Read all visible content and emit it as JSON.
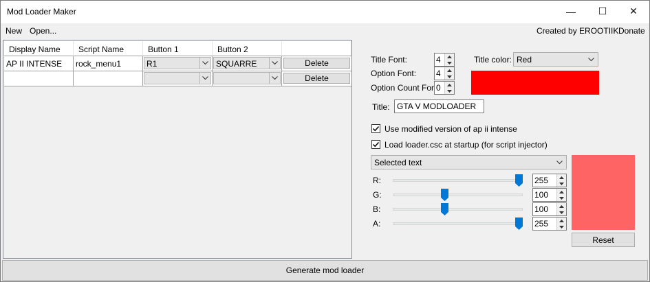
{
  "window": {
    "title": "Mod Loader Maker",
    "controls": {
      "minimize": "—",
      "maximize": "☐",
      "close": "✕"
    }
  },
  "menu": {
    "new_label": "New",
    "open_label": "Open...",
    "credit_label": "Created by EROOTIIK",
    "donate_label": "Donate"
  },
  "grid": {
    "columns": [
      "Display Name",
      "Script Name",
      "Button 1",
      "Button 2"
    ],
    "rows": [
      {
        "display_name": "AP II INTENSE",
        "script_name": "rock_menu1",
        "button1": "R1",
        "button2": "SQUARRE",
        "action": "Delete"
      },
      {
        "display_name": "",
        "script_name": "",
        "button1": "",
        "button2": "",
        "action": "Delete"
      }
    ]
  },
  "settings": {
    "title_font_label": "Title Font:",
    "title_font_value": "4",
    "option_font_label": "Option Font:",
    "option_font_value": "4",
    "option_count_font_label": "Option Count Font:",
    "option_count_font_value": "0",
    "title_color_label": "Title color:",
    "title_color_value": "Red",
    "title_color_swatch": "#ff0000",
    "title_label": "Title:",
    "title_value": "GTA V MODLOADER",
    "use_modified_label": "Use modified version of ap ii intense",
    "use_modified_checked": true,
    "load_loader_label": "Load loader.csc at startup (for script injector)",
    "load_loader_checked": true,
    "element_select_value": "Selected text"
  },
  "rgba": {
    "r_label": "R:",
    "r_value": "255",
    "g_label": "G:",
    "g_value": "100",
    "b_label": "B:",
    "b_value": "100",
    "a_label": "A:",
    "a_value": "255",
    "r_level": 255,
    "g_level": 100,
    "b_level": 100,
    "a_level": 255,
    "max": 255,
    "preview_color": "#ff6464",
    "reset_label": "Reset"
  },
  "footer": {
    "generate_label": "Generate mod loader"
  },
  "colors": {
    "accent": "#0078d7",
    "window_bg": "#f0f0f0"
  }
}
